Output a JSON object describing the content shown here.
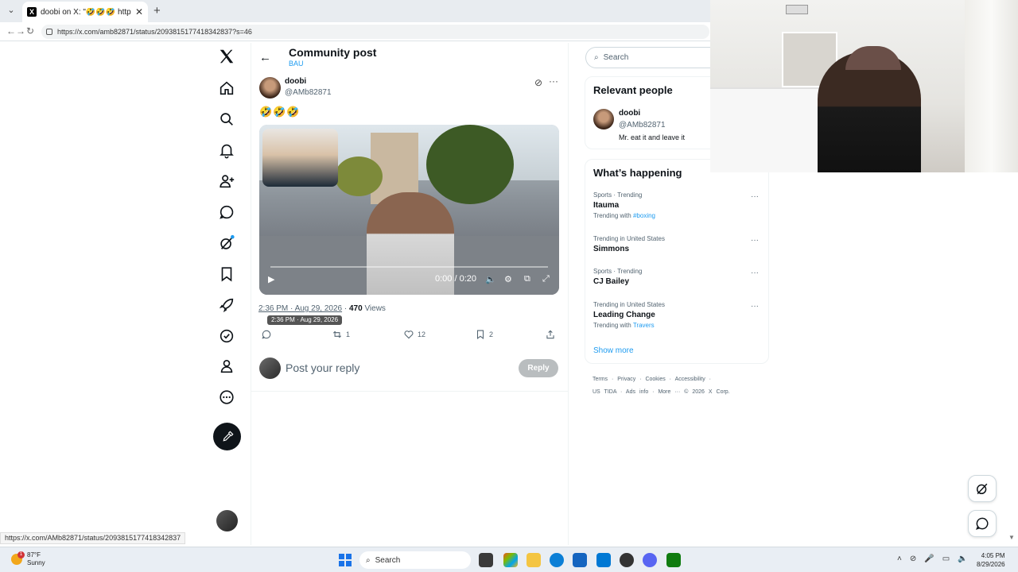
{
  "browser": {
    "tab_title": "doobi on X: \"🤣🤣🤣 https://t.co",
    "tab_close": "✕",
    "new_tab": "+",
    "url": "https://x.com/amb82871/status/2093815177418342837?s=46"
  },
  "post": {
    "header_title": "Community post",
    "header_subtitle": "BAU",
    "author_name": "doobi",
    "author_handle": "@AMb82871",
    "text": "🤣🤣🤣",
    "video_time": "0:00 / 0:20",
    "timestamp": "2:36 PM · Aug 29, 2026",
    "views_count": "470",
    "views_label": "Views",
    "tooltip": "2:36 PM · Aug 29, 2026",
    "retweets": "1",
    "likes": "12",
    "bookmarks": "2",
    "reply_placeholder": "Post your reply",
    "reply_button": "Reply"
  },
  "sidebar": {
    "search_placeholder": "Search",
    "relevant_title": "Relevant people",
    "relevant_person": {
      "name": "doobi",
      "handle": "@AMb82871",
      "bio": "Mr. eat it and leave it"
    },
    "happening_title": "What’s happening",
    "trends": [
      {
        "context": "Sports · Trending",
        "name": "Itauma",
        "with_label": "Trending with",
        "with_value": "#boxing"
      },
      {
        "context": "Trending in United States",
        "name": "Simmons",
        "with_label": "",
        "with_value": ""
      },
      {
        "context": "Sports · Trending",
        "name": "CJ Bailey",
        "with_label": "",
        "with_value": ""
      },
      {
        "context": "Trending in United States",
        "name": "Leading Change",
        "with_label": "Trending with",
        "with_value": "Travers"
      }
    ],
    "show_more": "Show more",
    "footer_line1": "Terms · Privacy · Cookies · Accessibility ·",
    "footer_line2": "US TIDA · Ads info · More ··· © 2026 X Corp."
  },
  "status_url": "https://x.com/AMb82871/status/2093815177418342837",
  "taskbar": {
    "weather_temp": "87°F",
    "weather_desc": "Sunny",
    "weather_badge": "1",
    "search": "Search",
    "time": "4:05 PM",
    "date": "8/29/2026"
  },
  "icons": {
    "nav": [
      "x-logo",
      "home-icon",
      "search-icon",
      "bell-icon",
      "people-icon",
      "messages-icon",
      "grok-icon",
      "bookmark-icon",
      "rocket-icon",
      "verified-icon",
      "profile-icon",
      "more-icon"
    ]
  }
}
